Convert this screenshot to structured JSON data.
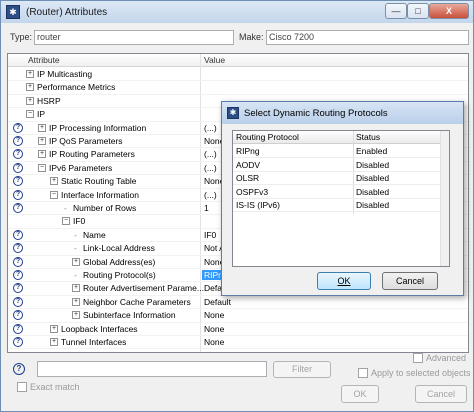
{
  "window": {
    "title": "(Router) Attributes",
    "min_label": "—",
    "max_label": "□",
    "close_label": "X"
  },
  "type": {
    "label": "Type:",
    "value": "router"
  },
  "make": {
    "label": "Make:",
    "value": "Cisco 7200"
  },
  "grid": {
    "col_attribute": "Attribute",
    "col_value": "Value",
    "rows": [
      {
        "name": "IP Multicasting",
        "value": "",
        "level": 1,
        "exp": "+",
        "q": false
      },
      {
        "name": "Performance Metrics",
        "value": "",
        "level": 1,
        "exp": "+",
        "q": false
      },
      {
        "name": "HSRP",
        "value": "",
        "level": 1,
        "exp": "+",
        "q": false
      },
      {
        "name": "IP",
        "value": "",
        "level": 1,
        "exp": "−",
        "q": false
      },
      {
        "name": "IP Processing Information",
        "value": "(...)",
        "level": 2,
        "exp": "+",
        "q": true
      },
      {
        "name": "IP QoS Parameters",
        "value": "None",
        "level": 2,
        "exp": "+",
        "q": true
      },
      {
        "name": "IP Routing Parameters",
        "value": "(...)",
        "level": 2,
        "exp": "+",
        "q": true
      },
      {
        "name": "IPv6 Parameters",
        "value": "(...)",
        "level": 2,
        "exp": "−",
        "q": true
      },
      {
        "name": "Static Routing Table",
        "value": "None",
        "level": 3,
        "exp": "+",
        "q": true
      },
      {
        "name": "Interface Information",
        "value": "(...)",
        "level": 3,
        "exp": "−",
        "q": true
      },
      {
        "name": "Number of Rows",
        "value": "1",
        "level": 4,
        "exp": "",
        "q": true
      },
      {
        "name": "IF0",
        "value": "",
        "level": 4,
        "exp": "−",
        "q": false
      },
      {
        "name": "Name",
        "value": "IF0",
        "level": 5,
        "exp": "",
        "q": true
      },
      {
        "name": "Link-Local Address",
        "value": "Not Active",
        "level": 5,
        "exp": "",
        "q": true
      },
      {
        "name": "Global Address(es)",
        "value": "None",
        "level": 5,
        "exp": "+",
        "q": true
      },
      {
        "name": "Routing Protocol(s)",
        "value": "RIPng",
        "level": 5,
        "exp": "",
        "q": true,
        "selected": true
      },
      {
        "name": "Router Advertisement Parame...",
        "value": "Default",
        "level": 5,
        "exp": "+",
        "q": true
      },
      {
        "name": "Neighbor Cache Parameters",
        "value": "Default",
        "level": 5,
        "exp": "+",
        "q": true
      },
      {
        "name": "Subinterface Information",
        "value": "None",
        "level": 5,
        "exp": "+",
        "q": true
      },
      {
        "name": "Loopback Interfaces",
        "value": "None",
        "level": 3,
        "exp": "+",
        "q": true
      },
      {
        "name": "Tunnel Interfaces",
        "value": "None",
        "level": 3,
        "exp": "+",
        "q": true
      }
    ]
  },
  "filter": {
    "button_label": "Filter",
    "exact_match_label": "Exact match",
    "advanced_label": "Advanced",
    "apply_selected_label": "Apply to selected objects",
    "ok_label": "OK",
    "cancel_label": "Cancel"
  },
  "dialog": {
    "title": "Select Dynamic Routing Protocols",
    "col_protocol": "Routing Protocol",
    "col_status": "Status",
    "rows": [
      {
        "protocol": "RIPng",
        "status": "Enabled"
      },
      {
        "protocol": "AODV",
        "status": "Disabled"
      },
      {
        "protocol": "OLSR",
        "status": "Disabled"
      },
      {
        "protocol": "OSPFv3",
        "status": "Disabled"
      },
      {
        "protocol": "IS-IS (IPv6)",
        "status": "Disabled"
      }
    ],
    "ok_label": "OK",
    "cancel_label": "Cancel"
  }
}
